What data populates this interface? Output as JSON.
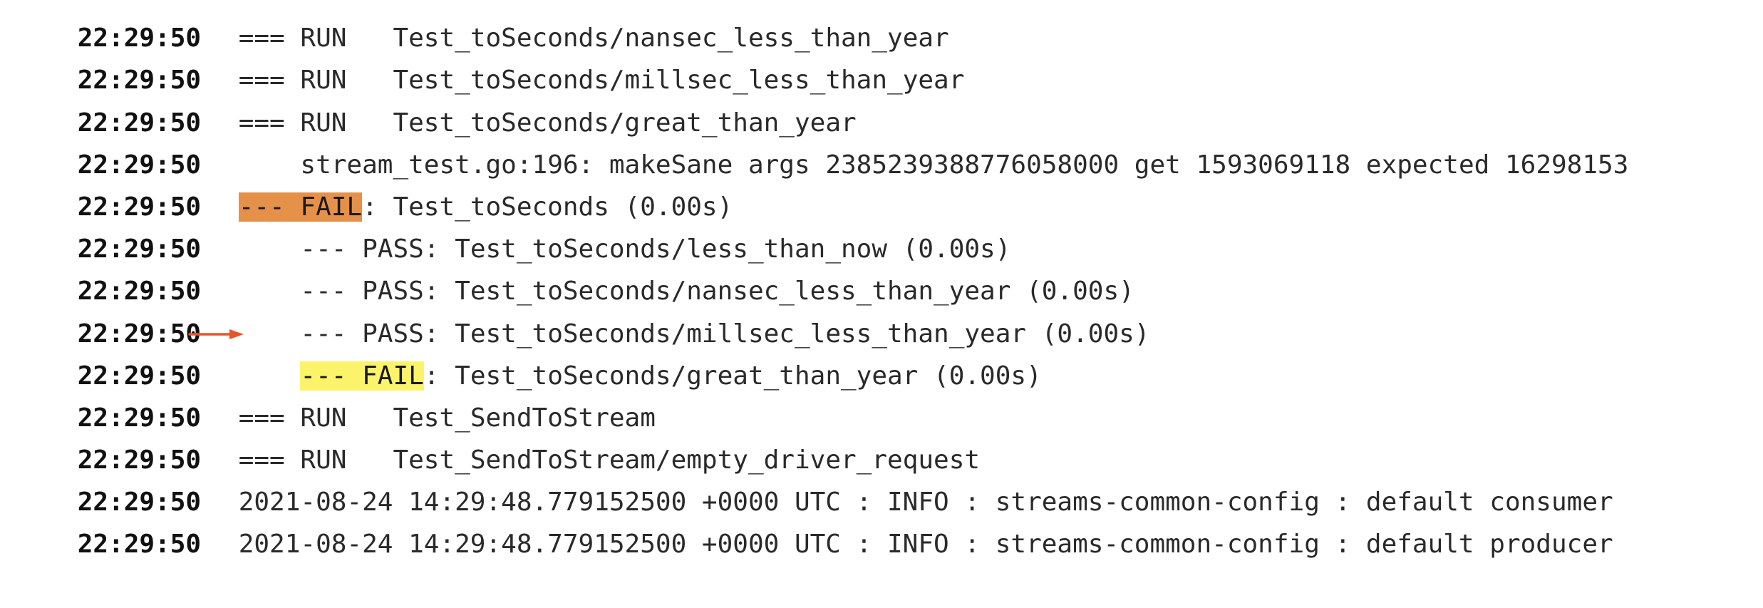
{
  "log_lines": [
    {
      "ts": "22:29:50",
      "prefix": "=== RUN   ",
      "highlight": "",
      "rest": "Test_toSeconds/nansec_less_than_year"
    },
    {
      "ts": "22:29:50",
      "prefix": "=== RUN   ",
      "highlight": "",
      "rest": "Test_toSeconds/millsec_less_than_year"
    },
    {
      "ts": "22:29:50",
      "prefix": "=== RUN   ",
      "highlight": "",
      "rest": "Test_toSeconds/great_than_year"
    },
    {
      "ts": "22:29:50",
      "prefix": "    ",
      "highlight": "",
      "rest": "stream_test.go:196: makeSane args 2385239388776058000 get 1593069118 expected 16298153"
    },
    {
      "ts": "22:29:50",
      "prefix": "",
      "highlight": "--- FAIL",
      "rest": ": Test_toSeconds (0.00s)"
    },
    {
      "ts": "22:29:50",
      "prefix": "    ",
      "highlight": "",
      "rest": "--- PASS: Test_toSeconds/less_than_now (0.00s)"
    },
    {
      "ts": "22:29:50",
      "prefix": "    ",
      "highlight": "",
      "rest": "--- PASS: Test_toSeconds/nansec_less_than_year (0.00s)"
    },
    {
      "ts": "22:29:50",
      "prefix": "    ",
      "highlight": "",
      "rest": "--- PASS: Test_toSeconds/millsec_less_than_year (0.00s)"
    },
    {
      "ts": "22:29:50",
      "prefix": "    ",
      "highlight": "--- FAIL",
      "rest": ": Test_toSeconds/great_than_year (0.00s)"
    },
    {
      "ts": "22:29:50",
      "prefix": "=== RUN   ",
      "highlight": "",
      "rest": "Test_SendToStream"
    },
    {
      "ts": "22:29:50",
      "prefix": "=== RUN   ",
      "highlight": "",
      "rest": "Test_SendToStream/empty_driver_request"
    },
    {
      "ts": "22:29:50",
      "prefix": "",
      "highlight": "",
      "rest": "2021-08-24 14:29:48.779152500 +0000 UTC : INFO : streams-common-config : default consumer"
    },
    {
      "ts": "22:29:50",
      "prefix": "",
      "highlight": "",
      "rest": "2021-08-24 14:29:48.779152500 +0000 UTC : INFO : streams-common-config : default producer"
    }
  ],
  "colors": {
    "fail_summary_highlight": "#e6914a",
    "fail_subtest_highlight": "#fbf46a",
    "arrow": "#e8552b"
  },
  "annotations": {
    "arrow_icon": "arrow-right-icon"
  }
}
